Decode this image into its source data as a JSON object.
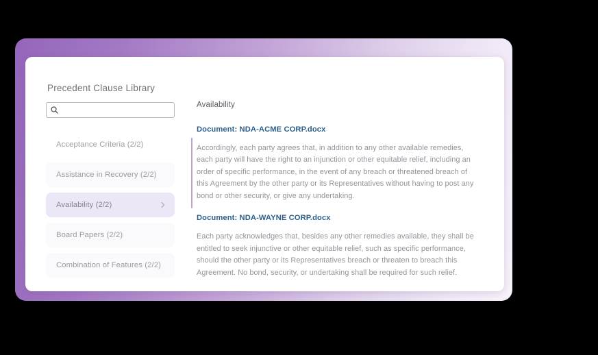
{
  "app": {
    "title": "Precedent Clause Library"
  },
  "search": {
    "icon": "search-icon",
    "value": "",
    "placeholder": ""
  },
  "sidebar": {
    "items": [
      {
        "label": "Acceptance Criteria (2/2)",
        "selected": false,
        "chevron": false
      },
      {
        "label": "Assistance in Recovery (2/2)",
        "selected": false,
        "chevron": false
      },
      {
        "label": "Availability (2/2)",
        "selected": true,
        "chevron": true
      },
      {
        "label": "Board Papers (2/2)",
        "selected": false,
        "chevron": false
      },
      {
        "label": "Combination of Features (2/2)",
        "selected": false,
        "chevron": false
      }
    ]
  },
  "detail": {
    "heading": "Availability",
    "documents": [
      {
        "title": "Document: NDA-ACME CORP.docx",
        "text": "Accordingly, each party agrees that, in addition to any other available remedies, each party will have the right to an injunction or other equitable relief, including an order of specific performance, in the event of any breach or threatened breach of this Agreement by the other party or its Representatives without having to post any bond or other security, or give any undertaking."
      },
      {
        "title": "Document: NDA-WAYNE CORP.docx",
        "text": "Each party acknowledges that, besides any other remedies available, they shall be entitled to seek injunctive or other equitable relief, such as specific performance, should the other party or its Representatives breach or threaten to breach this Agreement. No bond, security, or undertaking shall be required for such relief."
      }
    ]
  },
  "colors": {
    "frame_gradient_start": "#9466bb",
    "frame_gradient_end": "#f6f1fa",
    "selected_item_bg": "#ece7f6",
    "doc_title": "#2d5f8b",
    "body_text": "#93939c",
    "rule": "#b9a3c9",
    "backdrop": "#000000"
  }
}
